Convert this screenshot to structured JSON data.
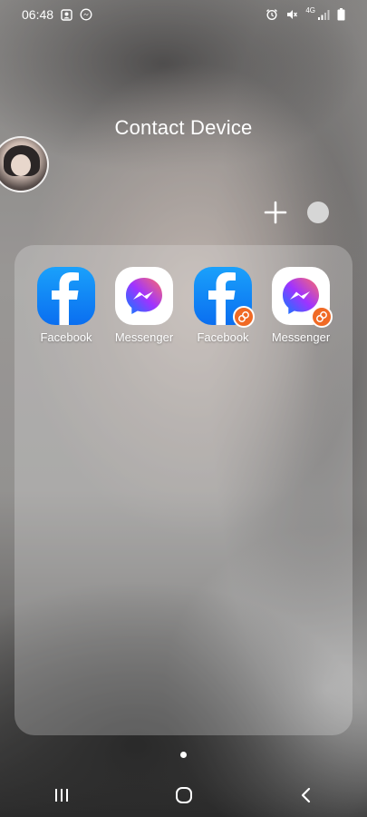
{
  "status_bar": {
    "time": "06:48",
    "network_label": "4G",
    "left_icons": [
      "gallery-notification-icon",
      "messenger-notification-icon"
    ],
    "right_icons": [
      "alarm-icon",
      "vibrate-mute-icon",
      "signal-icon",
      "battery-icon"
    ]
  },
  "folder": {
    "title": "Contact Device",
    "add_button_icon": "plus-icon",
    "color_button_color": "#d6d6d6"
  },
  "apps": [
    {
      "label": "Facebook",
      "icon": "facebook-icon",
      "dual": false
    },
    {
      "label": "Messenger",
      "icon": "messenger-icon",
      "dual": false
    },
    {
      "label": "Facebook",
      "icon": "facebook-icon",
      "dual": true
    },
    {
      "label": "Messenger",
      "icon": "messenger-icon",
      "dual": true
    }
  ],
  "navigation": {
    "recent_icon": "recent-apps-icon",
    "home_icon": "home-icon",
    "back_icon": "back-icon"
  },
  "colors": {
    "facebook_blue": "#0a6ef0",
    "dual_badge": "#f06a25"
  }
}
